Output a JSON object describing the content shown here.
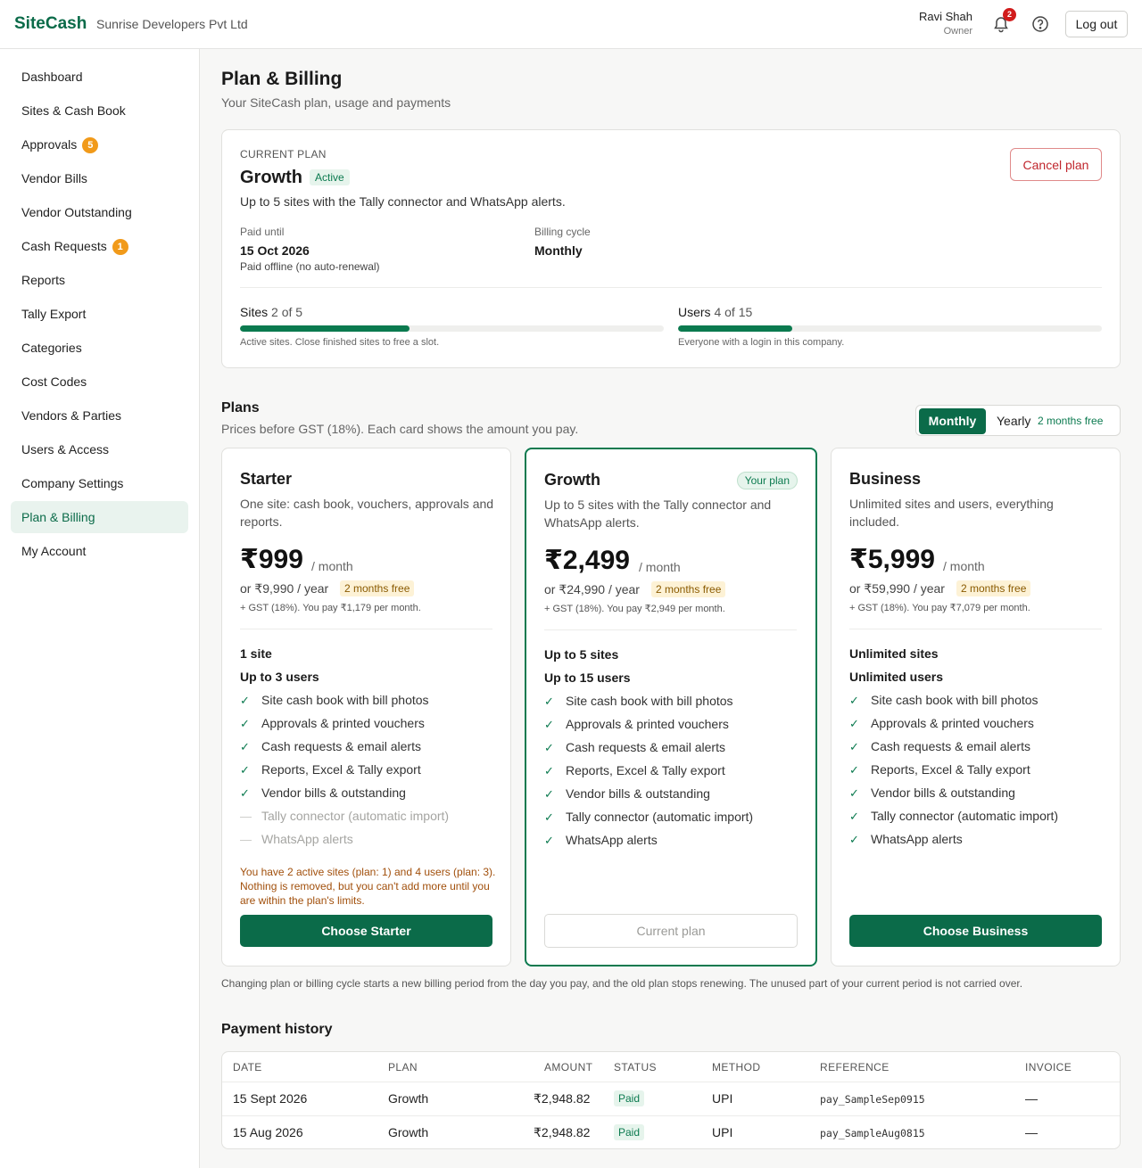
{
  "header": {
    "brand": "SiteCash",
    "company": "Sunrise Developers Pvt Ltd",
    "user_name": "Ravi Shah",
    "user_role": "Owner",
    "notification_count": "2",
    "logout_label": "Log out"
  },
  "sidebar": {
    "items": [
      {
        "label": "Dashboard"
      },
      {
        "label": "Sites & Cash Book"
      },
      {
        "label": "Approvals",
        "count": "5"
      },
      {
        "label": "Vendor Bills"
      },
      {
        "label": "Vendor Outstanding"
      },
      {
        "label": "Cash Requests",
        "count": "1"
      },
      {
        "label": "Reports"
      },
      {
        "label": "Tally Export"
      },
      {
        "label": "Categories"
      },
      {
        "label": "Cost Codes"
      },
      {
        "label": "Vendors & Parties"
      },
      {
        "label": "Users & Access"
      },
      {
        "label": "Company Settings"
      },
      {
        "label": "Plan & Billing",
        "active": true
      },
      {
        "label": "My Account"
      }
    ]
  },
  "page": {
    "title": "Plan & Billing",
    "subtitle": "Your SiteCash plan, usage and payments"
  },
  "current_plan": {
    "label": "CURRENT PLAN",
    "name": "Growth",
    "status": "Active",
    "description": "Up to 5 sites with the Tally connector and WhatsApp alerts.",
    "cancel_label": "Cancel plan",
    "paid_until_label": "Paid until",
    "paid_until": "15 Oct 2026",
    "paid_note": "Paid offline (no auto-renewal)",
    "cycle_label": "Billing cycle",
    "cycle": "Monthly",
    "sites_label": "Sites",
    "sites_usage": "2 of 5",
    "sites_fraction": 0.4,
    "sites_note": "Active sites. Close finished sites to free a slot.",
    "users_label": "Users",
    "users_usage": "4 of 15",
    "users_fraction": 0.27,
    "users_note": "Everyone with a login in this company."
  },
  "plans_section": {
    "title": "Plans",
    "subtitle": "Prices before GST (18%). Each card shows the amount you pay.",
    "toggle_monthly": "Monthly",
    "toggle_yearly": "Yearly",
    "toggle_yearly_note": "2 months free"
  },
  "plans": [
    {
      "name": "Starter",
      "description": "One site: cash book, vouchers, approvals and reports.",
      "price": "₹999",
      "per": "/ month",
      "yearly": "or ₹9,990 / year",
      "free_tag": "2 months free",
      "gst": "+ GST (18%). You pay ₹1,179 per month.",
      "limit_sites": "1 site",
      "limit_users": "Up to 3 users",
      "features": [
        {
          "text": "Site cash book with bill photos",
          "included": true
        },
        {
          "text": "Approvals & printed vouchers",
          "included": true
        },
        {
          "text": "Cash requests & email alerts",
          "included": true
        },
        {
          "text": "Reports, Excel & Tally export",
          "included": true
        },
        {
          "text": "Vendor bills & outstanding",
          "included": true
        },
        {
          "text": "Tally connector (automatic import)",
          "included": false
        },
        {
          "text": "WhatsApp alerts",
          "included": false
        }
      ],
      "warning": "You have 2 active sites (plan: 1) and 4 users (plan: 3). Nothing is removed, but you can't add more until you are within the plan's limits.",
      "button": "Choose Starter"
    },
    {
      "name": "Growth",
      "badge": "Your plan",
      "description": "Up to 5 sites with the Tally connector and WhatsApp alerts.",
      "price": "₹2,499",
      "per": "/ month",
      "yearly": "or ₹24,990 / year",
      "free_tag": "2 months free",
      "gst": "+ GST (18%). You pay ₹2,949 per month.",
      "limit_sites": "Up to 5 sites",
      "limit_users": "Up to 15 users",
      "features": [
        {
          "text": "Site cash book with bill photos",
          "included": true
        },
        {
          "text": "Approvals & printed vouchers",
          "included": true
        },
        {
          "text": "Cash requests & email alerts",
          "included": true
        },
        {
          "text": "Reports, Excel & Tally export",
          "included": true
        },
        {
          "text": "Vendor bills & outstanding",
          "included": true
        },
        {
          "text": "Tally connector (automatic import)",
          "included": true
        },
        {
          "text": "WhatsApp alerts",
          "included": true
        }
      ],
      "button": "Current plan"
    },
    {
      "name": "Business",
      "description": "Unlimited sites and users, everything included.",
      "price": "₹5,999",
      "per": "/ month",
      "yearly": "or ₹59,990 / year",
      "free_tag": "2 months free",
      "gst": "+ GST (18%). You pay ₹7,079 per month.",
      "limit_sites": "Unlimited sites",
      "limit_users": "Unlimited users",
      "features": [
        {
          "text": "Site cash book with bill photos",
          "included": true
        },
        {
          "text": "Approvals & printed vouchers",
          "included": true
        },
        {
          "text": "Cash requests & email alerts",
          "included": true
        },
        {
          "text": "Reports, Excel & Tally export",
          "included": true
        },
        {
          "text": "Vendor bills & outstanding",
          "included": true
        },
        {
          "text": "Tally connector (automatic import)",
          "included": true
        },
        {
          "text": "WhatsApp alerts",
          "included": true
        }
      ],
      "button": "Choose Business"
    }
  ],
  "change_note": "Changing plan or billing cycle starts a new billing period from the day you pay, and the old plan stops renewing. The unused part of your current period is not carried over.",
  "payment_history": {
    "title": "Payment history",
    "columns": [
      "DATE",
      "PLAN",
      "AMOUNT",
      "STATUS",
      "METHOD",
      "REFERENCE",
      "INVOICE"
    ],
    "rows": [
      {
        "date": "15 Sept 2026",
        "plan": "Growth",
        "amount": "₹2,948.82",
        "status": "Paid",
        "method": "UPI",
        "reference": "pay_SampleSep0915",
        "invoice": "—"
      },
      {
        "date": "15 Aug 2026",
        "plan": "Growth",
        "amount": "₹2,948.82",
        "status": "Paid",
        "method": "UPI",
        "reference": "pay_SampleAug0815",
        "invoice": "—"
      }
    ]
  },
  "colors": {
    "brand": "#0b6b49",
    "danger": "#c0262d",
    "warning": "#a14f0b"
  }
}
